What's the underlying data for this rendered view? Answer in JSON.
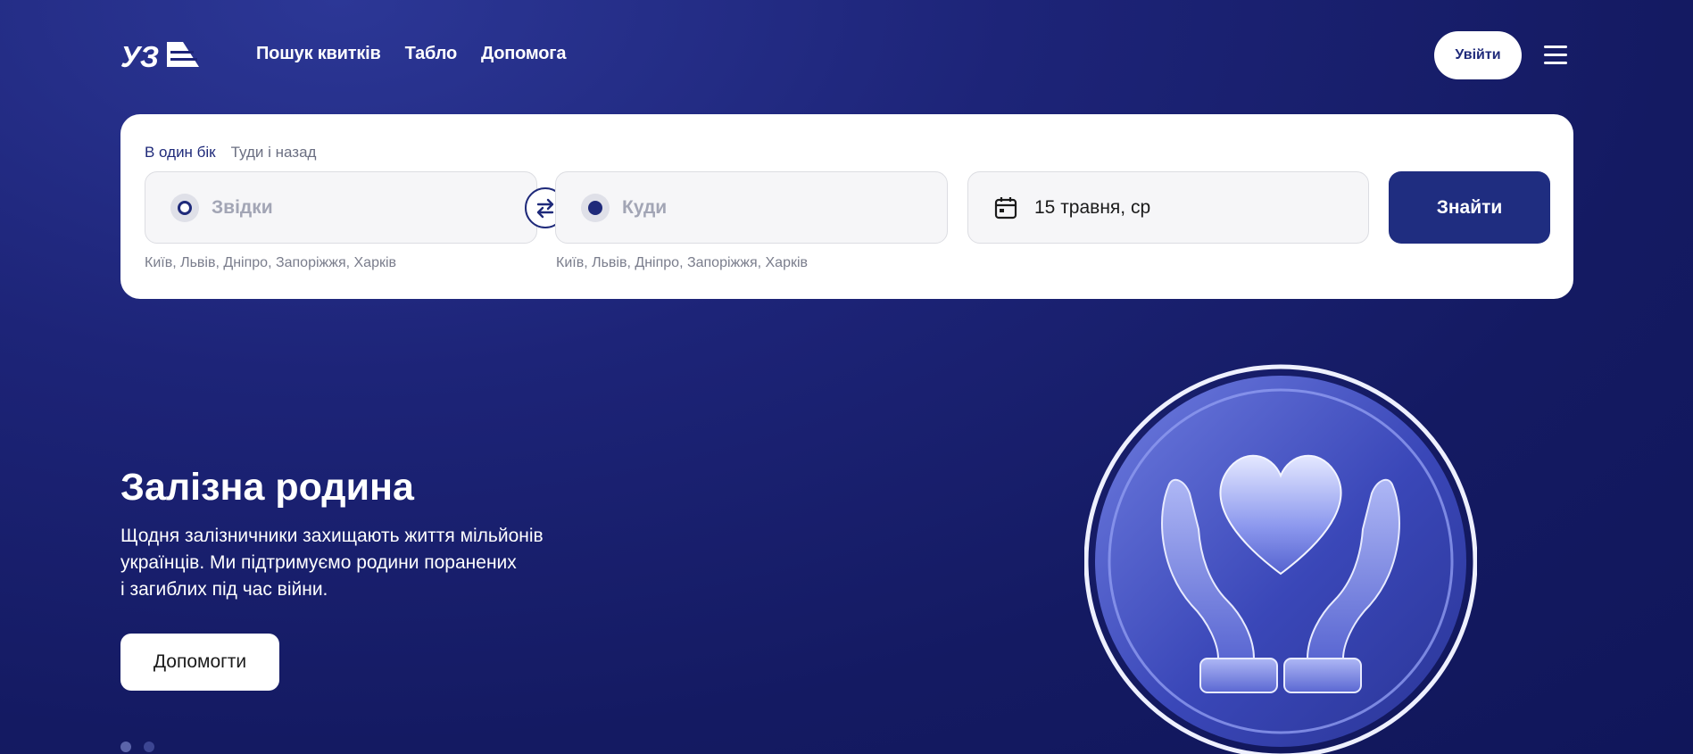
{
  "header": {
    "logo_text": "УЗ",
    "nav": [
      "Пошук квитків",
      "Табло",
      "Допомога"
    ],
    "login_label": "Увійти"
  },
  "search": {
    "tabs": [
      "В один бік",
      "Туди і назад"
    ],
    "active_tab": 0,
    "from_placeholder": "Звідки",
    "to_placeholder": "Куди",
    "from_hint": "Київ, Львів, Дніпро, Запоріжжя, Харків",
    "to_hint": "Київ, Львів, Дніпро, Запоріжжя, Харків",
    "date_value": "15 травня, ср",
    "find_label": "Знайти"
  },
  "hero": {
    "title": "Залізна родина",
    "text_lines": [
      "Щодня залізничники захищають життя мільйонів",
      "українців. Ми підтримуємо родини поранених",
      "і загиблих під час війни."
    ],
    "button_label": "Допомогти",
    "slides_total": 2,
    "slide_active": 0
  },
  "colors": {
    "brand_navy": "#1f2a7a",
    "background": "#141a62",
    "white": "#ffffff"
  },
  "icons": {
    "swap": "swap-arrows-icon",
    "calendar": "calendar-icon",
    "menu": "hamburger-menu-icon",
    "illustration": "heart-in-hands-icon"
  }
}
